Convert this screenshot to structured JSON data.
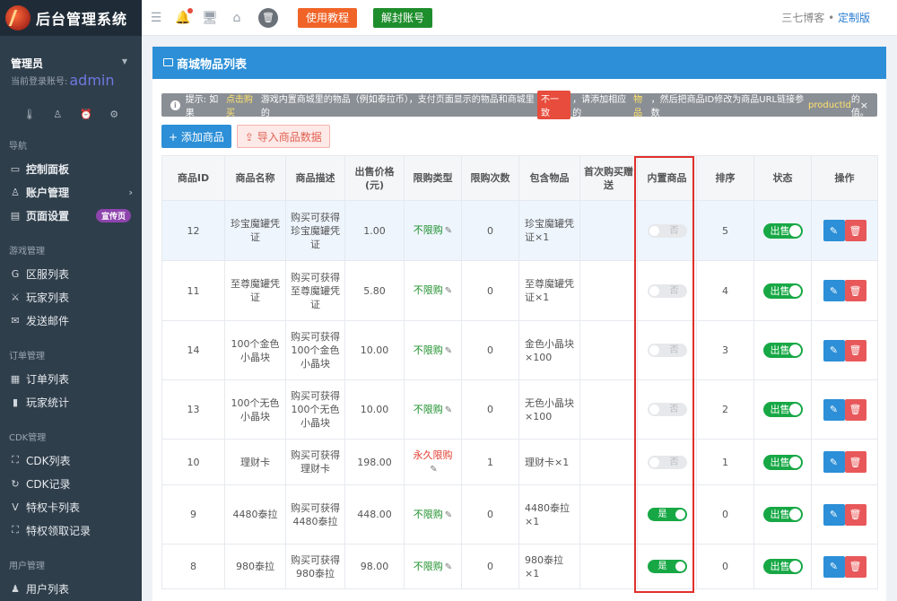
{
  "app": {
    "title": "后台管理系统"
  },
  "user": {
    "role": "管理员",
    "account_label": "当前登录账号:",
    "account_name": "admin"
  },
  "user_icons": [
    "thermometer-icon",
    "user-icon",
    "alarm-icon",
    "gear-icon"
  ],
  "nav": {
    "sections": [
      {
        "title": "导航",
        "items": [
          {
            "label": "控制面板",
            "icon": "dashboard-icon"
          },
          {
            "label": "账户管理",
            "icon": "user-icon",
            "arrow": "›"
          },
          {
            "label": "页面设置",
            "icon": "page-icon",
            "badge": "宣传页"
          }
        ]
      },
      {
        "title": "游戏管理",
        "items": [
          {
            "label": "区服列表",
            "icon": "g-icon"
          },
          {
            "label": "玩家列表",
            "icon": "players-icon"
          },
          {
            "label": "发送邮件",
            "icon": "mail-icon"
          }
        ]
      },
      {
        "title": "订单管理",
        "items": [
          {
            "label": "订单列表",
            "icon": "clipboard-icon"
          },
          {
            "label": "玩家统计",
            "icon": "bar-chart-icon"
          }
        ]
      },
      {
        "title": "CDK管理",
        "items": [
          {
            "label": "CDK列表",
            "icon": "gift-icon"
          },
          {
            "label": "CDK记录",
            "icon": "refresh-icon"
          },
          {
            "label": "特权卡列表",
            "icon": "vip-icon"
          },
          {
            "label": "特权领取记录",
            "icon": "gift-icon"
          }
        ]
      },
      {
        "title": "用户管理",
        "items": [
          {
            "label": "用户列表",
            "icon": "users-icon"
          }
        ]
      }
    ]
  },
  "topbar": {
    "tutorial_label": "使用教程",
    "unban_label": "解封账号",
    "brand": "三七博客",
    "separator": " • ",
    "custom_label": "定制版"
  },
  "panel": {
    "title": "商城物品列表",
    "tip": {
      "prefix": "提示: 如果",
      "link1": "点击购买",
      "mid1": "游戏内置商城里的物品（例如泰拉币），支付页面显示的物品和商城里的",
      "badge": "不一致",
      "mid2": "，请添加相应的",
      "link2": "物品",
      "mid3": "，然后把商品ID修改为商品URL链接参数",
      "link3": "productId",
      "suffix": "的值。",
      "close": "×"
    },
    "add_button": "+ 添加商品",
    "import_button": "⇪ 导入商品数据"
  },
  "table": {
    "columns": [
      "商品ID",
      "商品名称",
      "商品描述",
      "出售价格(元)",
      "限购类型",
      "限购次数",
      "包含物品",
      "首次购买赠送",
      "内置商品",
      "排序",
      "状态",
      "操作"
    ],
    "rows": [
      {
        "id": "12",
        "name": "珍宝魔罐凭证",
        "desc": "购买可获得珍宝魔罐凭证",
        "price": "1.00",
        "limit_type": "不限购",
        "limit_type_color": "green",
        "limit_count": "0",
        "items": "珍宝魔罐凭证×1",
        "first_gift": "",
        "builtin": "否",
        "builtin_on": false,
        "sort": "5",
        "status": "出售",
        "highlight": true
      },
      {
        "id": "11",
        "name": "至尊魔罐凭证",
        "desc": "购买可获得至尊魔罐凭证",
        "price": "5.80",
        "limit_type": "不限购",
        "limit_type_color": "green",
        "limit_count": "0",
        "items": "至尊魔罐凭证×1",
        "first_gift": "",
        "builtin": "否",
        "builtin_on": false,
        "sort": "4",
        "status": "出售",
        "highlight": false
      },
      {
        "id": "14",
        "name": "100个金色小晶块",
        "desc": "购买可获得100个金色小晶块",
        "price": "10.00",
        "limit_type": "不限购",
        "limit_type_color": "green",
        "limit_count": "0",
        "items": "金色小晶块×100",
        "first_gift": "",
        "builtin": "否",
        "builtin_on": false,
        "sort": "3",
        "status": "出售",
        "highlight": false
      },
      {
        "id": "13",
        "name": "100个无色小晶块",
        "desc": "购买可获得100个无色小晶块",
        "price": "10.00",
        "limit_type": "不限购",
        "limit_type_color": "green",
        "limit_count": "0",
        "items": "无色小晶块×100",
        "first_gift": "",
        "builtin": "否",
        "builtin_on": false,
        "sort": "2",
        "status": "出售",
        "highlight": false
      },
      {
        "id": "10",
        "name": "理财卡",
        "desc": "购买可获得理财卡",
        "price": "198.00",
        "limit_type": "永久限购",
        "limit_type_color": "red",
        "limit_count": "1",
        "items": "理财卡×1",
        "first_gift": "",
        "builtin": "否",
        "builtin_on": false,
        "sort": "1",
        "status": "出售",
        "highlight": false
      },
      {
        "id": "9",
        "name": "4480泰拉",
        "desc": "购买可获得4480泰拉",
        "price": "448.00",
        "limit_type": "不限购",
        "limit_type_color": "green",
        "limit_count": "0",
        "items": "4480泰拉×1",
        "first_gift": "",
        "builtin": "是",
        "builtin_on": true,
        "sort": "0",
        "status": "出售",
        "highlight": false
      },
      {
        "id": "8",
        "name": "980泰拉",
        "desc": "购买可获得980泰拉",
        "price": "98.00",
        "limit_type": "不限购",
        "limit_type_color": "green",
        "limit_count": "0",
        "items": "980泰拉×1",
        "first_gift": "",
        "builtin": "是",
        "builtin_on": true,
        "sort": "0",
        "status": "出售",
        "highlight": false
      }
    ]
  },
  "colors": {
    "sidebar_bg": "#2f3e4b",
    "accent_blue": "#2c8fd7",
    "on_green": "#17a845",
    "delete_red": "#e8585a",
    "highlight_box": "#e0302b"
  }
}
